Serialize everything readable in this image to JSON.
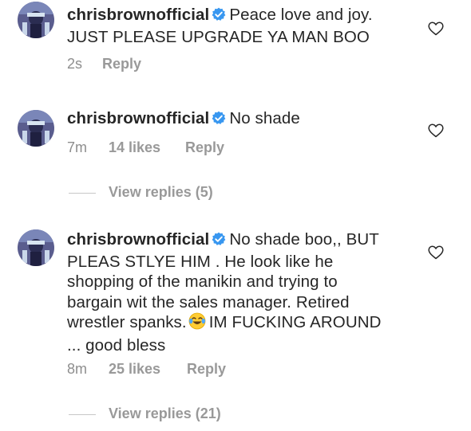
{
  "comments": [
    {
      "username": "chrisbrownofficial",
      "text_line1": "Peace love and joy.",
      "text_rest": "JUST PLEASE UPGRADE YA MAN BOO",
      "time": "2s",
      "likes": "",
      "reply": "Reply",
      "view_replies": ""
    },
    {
      "username": "chrisbrownofficial",
      "text_line1": "No shade",
      "text_rest": "",
      "time": "7m",
      "likes": "14 likes",
      "reply": "Reply",
      "view_replies": "View replies (5)"
    },
    {
      "username": "chrisbrownofficial",
      "text_line1": "No shade boo,,",
      "text_rest": "BUT PLEAS STLYE HIM . He look like he shopping of the manikin and trying to bargain wit the sales manager. Retired wrestler spanks.",
      "text_after_emoji": "IM FUCKING AROUND ... good bless",
      "time": "8m",
      "likes": "25 likes",
      "reply": "Reply",
      "view_replies": "View replies (21)"
    }
  ],
  "icons": {
    "verified": "verified-badge-icon",
    "heart": "heart-outline-icon",
    "emoji": "tears-of-joy-emoji-icon"
  },
  "colors": {
    "text": "#262626",
    "muted": "#8e8e8e",
    "verified": "#3897f0"
  }
}
